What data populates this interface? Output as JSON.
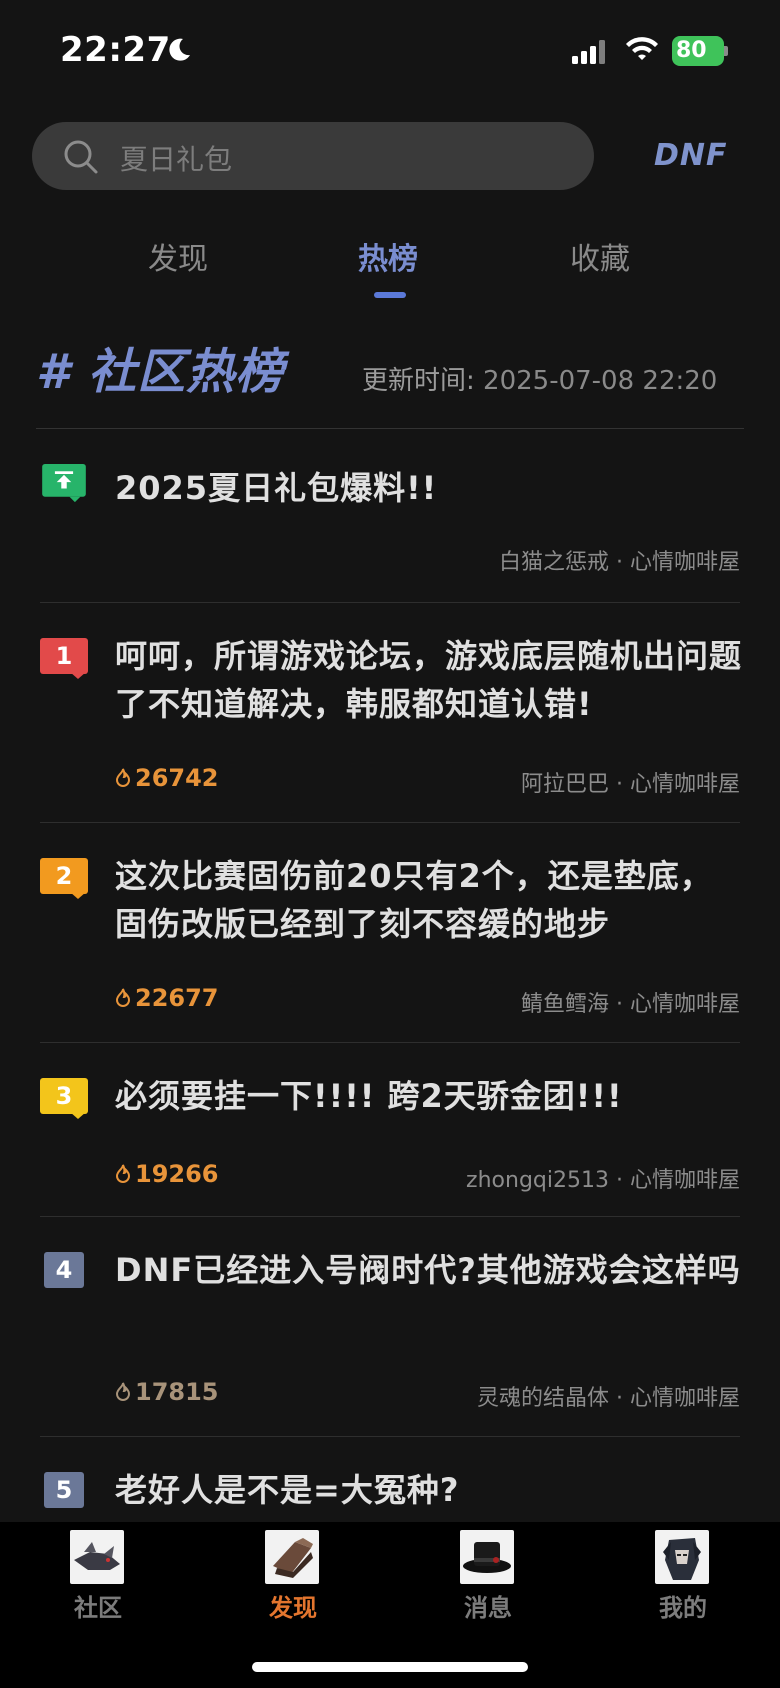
{
  "status_bar": {
    "time": "22:27",
    "battery": "80"
  },
  "search": {
    "placeholder": "夏日礼包"
  },
  "brand": "DNF",
  "tabs": [
    {
      "label": "发现",
      "active": false
    },
    {
      "label": "热榜",
      "active": true
    },
    {
      "label": "收藏",
      "active": false
    }
  ],
  "hot_list": {
    "title": "# 社区热榜",
    "update_label": "更新时间:",
    "update_time": "2025-07-08 22:20"
  },
  "posts": [
    {
      "rank": "",
      "badge": "pinned",
      "title": "2025夏日礼包爆料!!",
      "heat": "",
      "author": "白猫之惩戒",
      "board": "心情咖啡屋"
    },
    {
      "rank": "1",
      "badge": "red",
      "title": "呵呵，所谓游戏论坛，游戏底层随机出问题了不知道解决，韩服都知道认错!",
      "heat": "26742",
      "author": "阿拉巴巴",
      "board": "心情咖啡屋"
    },
    {
      "rank": "2",
      "badge": "orange",
      "title": "这次比赛固伤前20只有2个，还是垫底，固伤改版已经到了刻不容缓的地步",
      "heat": "22677",
      "author": "鲭鱼鳕海",
      "board": "心情咖啡屋"
    },
    {
      "rank": "3",
      "badge": "yellow",
      "title": "必须要挂一下!!!! 跨2天骄金团!!!",
      "heat": "19266",
      "author": "zhongqi2513",
      "board": "心情咖啡屋"
    },
    {
      "rank": "4",
      "badge": "plain",
      "title": "DNF已经进入号阀时代?其他游戏会这样吗",
      "heat": "17815",
      "author": "灵魂的结晶体",
      "board": "心情咖啡屋"
    },
    {
      "rank": "5",
      "badge": "plain",
      "title": "老好人是不是=大冤种?",
      "heat": "",
      "author": "",
      "board": ""
    }
  ],
  "meta_separator": "·",
  "bottom_nav": [
    {
      "label": "社区",
      "active": false,
      "icon": "community-icon"
    },
    {
      "label": "发现",
      "active": true,
      "icon": "discover-icon"
    },
    {
      "label": "消息",
      "active": false,
      "icon": "messages-icon"
    },
    {
      "label": "我的",
      "active": false,
      "icon": "profile-icon"
    }
  ],
  "colors": {
    "accent": "#7a8dd0",
    "active_nav": "#e3752e",
    "heat": "#e8943a",
    "rank1": "#e24a4a",
    "rank2": "#f29a1f",
    "rank3": "#f3c51b",
    "pinned": "#27b46a"
  }
}
